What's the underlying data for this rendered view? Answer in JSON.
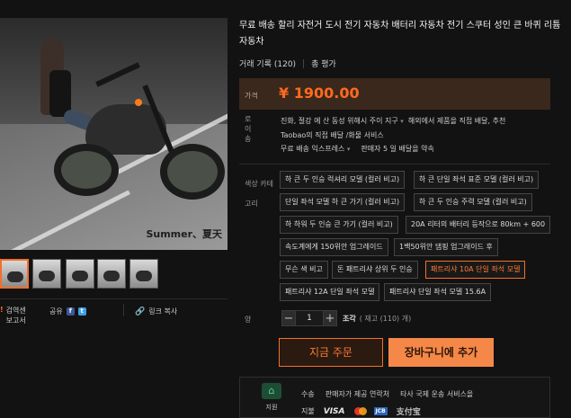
{
  "product": {
    "title": "무료 배송 할리 자전거 도시 전기 자동차 배터리 자동차 전기 스쿠터 성인 큰 바퀴 리튬 자동차",
    "trade_record_label": "거래 기록",
    "trade_record_count": "(120)",
    "total_rating_label": "총 평가",
    "price_label": "가격",
    "price": "¥ 1900.00"
  },
  "image": {
    "caption": "Summer、夏天",
    "thumbnail_count": 5,
    "active_thumbnail": 0
  },
  "left_actions": {
    "report_icon": "!",
    "report_label_1": "검역센",
    "report_label_2": "보고서",
    "share_label": "공유",
    "facebook_icon": "f",
    "twitter_icon": "t",
    "copy_link_label": "링크 복사"
  },
  "shipping": {
    "label": "로 이송",
    "line1": "진화, 절강 에  산 동성 위해시 주이 지구",
    "line1_rest": "해외에서 제품을 직접 배달, 추천",
    "line2": "Taobao의 직접 배달 /화물 서비스",
    "method": "무료 배송 익스프레스",
    "promise": "판매자 5 일 배달을 약속"
  },
  "options": {
    "label_1": "색상 카테",
    "label_2": "고리",
    "items": [
      "하 큰 두 인승 럭셔리 모델 (컬러 비고)",
      "하 큰 단일 좌석 표준 모델 (컬러 비고)",
      "단일 좌석 모델 하 큰 가기 (컬러 비고)",
      "하 큰 두 인승 주력 모델 (컬러 비고)",
      "하 하워 두 인승 큰 가기 (컬러 비고)",
      "20A 리터의 배터리 등작으로 80km + 600",
      "속도계에게 150위안 업그레이드",
      "1백50위안 댐핑 업그레이드 후",
      "무슨 색 비고",
      "돈 패트리샤 상위 두 인승",
      "패트리샤 10A 단일 좌석 모델",
      "패트리샤 12A 단일 좌석 모델",
      "패트리샤 단일 좌석 모델 15.6A"
    ],
    "selected_index": 10
  },
  "quantity": {
    "label": "양",
    "minus": "−",
    "value": "1",
    "plus": "+",
    "unit": "조각",
    "stock": "( 재고 (110) 개)"
  },
  "actions": {
    "buy_now": "지금 주문",
    "add_to_cart": "장바구니에 추가"
  },
  "service": {
    "icon_glyph": "⌂",
    "icon_label": "지원",
    "line1": [
      "수송",
      "판매자가 제공 연락처",
      "타사 국제 운송 서비스을"
    ],
    "payment_label": "지불",
    "visa": "VISA",
    "jcb": "JCB",
    "alipay": "支付宝"
  },
  "colors": {
    "accent": "#f56f28",
    "price": "#ff6a1f",
    "cart_button": "#f58848",
    "background": "#121212"
  }
}
